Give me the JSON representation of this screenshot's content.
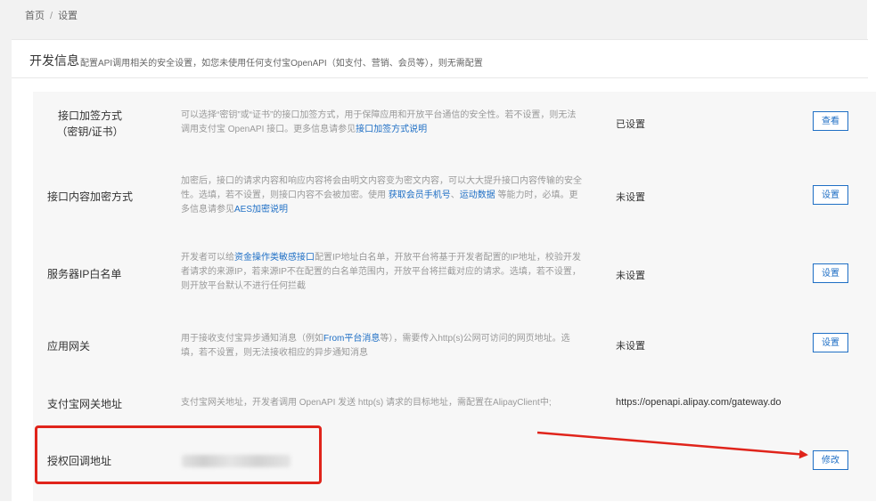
{
  "breadcrumb": {
    "home": "首页",
    "separator": "/",
    "current": "设置"
  },
  "panel": {
    "title": "开发信息",
    "description": "配置API调用相关的安全设置，如您未使用任何支付宝OpenAPI（如支付、营销、会员等），则无需配置"
  },
  "rows": [
    {
      "label_line1": "接口加签方式",
      "label_line2": "（密钥/证书）",
      "desc": [
        "可以选择“密钥”或“证书”的接口加签方式，用于保障应用和开放平台通信的安全性。若不设置，则无法调用支付宝 OpenAPI 接口。更多信息请参见",
        "接口加签方式说明"
      ],
      "status": "已设置",
      "button": "查看"
    },
    {
      "label": "接口内容加密方式",
      "desc": [
        "加密后，接口的请求内容和响应内容将会由明文内容变为密文内容，可以大大提升接口内容传输的安全性。选填，若不设置，则接口内容不会被加密。使用 ",
        "获取会员手机号",
        "、",
        "运动数据",
        " 等能力时，必填。更多信息请参见",
        "AES加密说明"
      ],
      "status": "未设置",
      "button": "设置"
    },
    {
      "label": "服务器IP白名单",
      "desc": [
        "开发者可以给",
        "资金操作类敏感接口",
        "配置IP地址白名单，开放平台将基于开发者配置的IP地址，校验开发者请求的来源IP，若来源IP不在配置的白名单范围内，开放平台将拦截对应的请求。选填，若不设置，则开放平台默认不进行任何拦截"
      ],
      "status": "未设置",
      "button": "设置"
    },
    {
      "label": "应用网关",
      "desc": [
        "用于接收支付宝异步通知消息（例如",
        "From平台消息",
        "等），需要传入http(s)公网可访问的网页地址。选填，若不设置，则无法接收相应的异步通知消息"
      ],
      "status": "未设置",
      "button": "设置"
    },
    {
      "label": "支付宝网关地址",
      "desc": [
        "支付宝网关地址，开发者调用 OpenAPI 发送 http(s) 请求的目标地址，需配置在AlipayClient中;"
      ],
      "status": "https://openapi.alipay.com/gateway.do"
    },
    {
      "label": "授权回调地址",
      "button": "修改"
    }
  ],
  "colors": {
    "link": "#1f6fc5",
    "annotation": "#e0241b"
  }
}
